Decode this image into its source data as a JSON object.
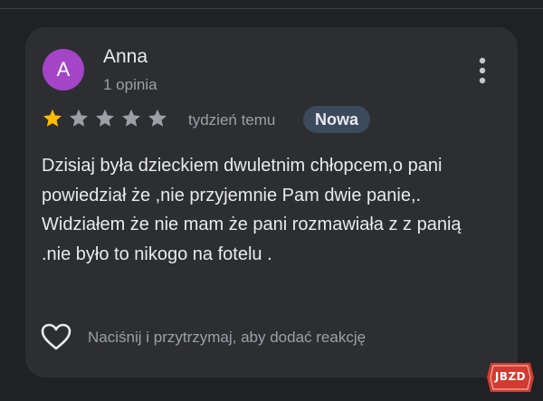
{
  "review": {
    "avatar_letter": "A",
    "author_name": "Anna",
    "review_count": "1 opinia",
    "rating": 1,
    "rating_max": 5,
    "time_ago": "tydzień temu",
    "badge": "Nowa",
    "text": "Dzisiaj była dzieckiem dwuletnim chłopcem,o pani powiedział że ,nie przyjemnie Pam dwie panie,. Widziałem że nie mam że pani rozmawiała z z panią .nie było to nikogo na fotelu .",
    "reaction_hint": "Naciśnij i przytrzymaj, aby dodać reakcję"
  },
  "icons": {
    "more": "more-vert-icon",
    "star": "star-icon",
    "reaction": "heart-outline-icon"
  },
  "watermark": {
    "text": "JBZD"
  },
  "colors": {
    "background": "#202124",
    "card": "#2d2e31",
    "avatar": "#a444c7",
    "star_filled": "#fbbc04",
    "star_empty": "#9aa0a6",
    "badge_bg": "#3c4a5e",
    "primary_text": "#e8eaed",
    "secondary_text": "#9aa0a6"
  }
}
